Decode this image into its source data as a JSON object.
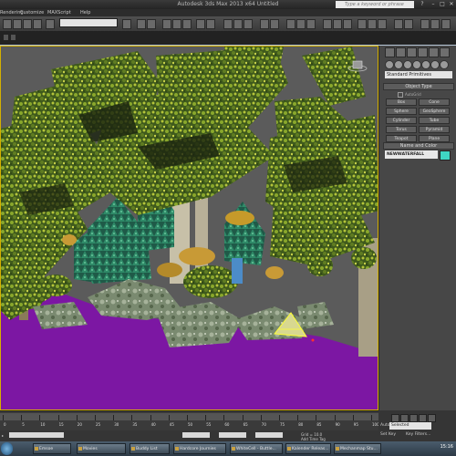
{
  "window": {
    "title": "Autodesk 3ds Max 2013 x64    Untitled",
    "search_placeholder": "Type a keyword or phrase"
  },
  "menubar": {
    "items": [
      "Rendering",
      "Customize",
      "MAXScript",
      "Help"
    ]
  },
  "toolbar": {
    "selection_set_placeholder": ""
  },
  "command_panel": {
    "dropdown": "Standard Primitives",
    "object_type_label": "Object Type",
    "autogrid_label": "AutoGrid",
    "buttons": [
      "Box",
      "Cone",
      "Sphere",
      "GeoSphere",
      "Cylinder",
      "Tube",
      "Torus",
      "Pyramid",
      "Teapot",
      "Plane"
    ],
    "name_color_label": "Name and Color",
    "object_name": "NEWWATERFALL",
    "object_color": "#3fd6c4"
  },
  "timeline": {
    "ticks": [
      "0",
      "5",
      "10",
      "15",
      "20",
      "25",
      "30",
      "35",
      "40",
      "45",
      "50",
      "55",
      "60",
      "65",
      "70",
      "75",
      "80",
      "85",
      "90",
      "95",
      "100"
    ]
  },
  "statusbar": {
    "grid_label": "Grid = 10.0",
    "add_time_tag": "Add Time Tag",
    "set_key": "Set Key",
    "key_filters": "Key Filters...",
    "auto_key": "Auto Key",
    "selected": "Selected"
  },
  "taskbar": {
    "tasks": [
      "Emsoe",
      "Movies",
      "Buddy List",
      "Hardcore Journies",
      "WhiteCell - Buttle...",
      "Kalender Releas...",
      "Mechanmap Stu..."
    ],
    "time": "15:16"
  }
}
